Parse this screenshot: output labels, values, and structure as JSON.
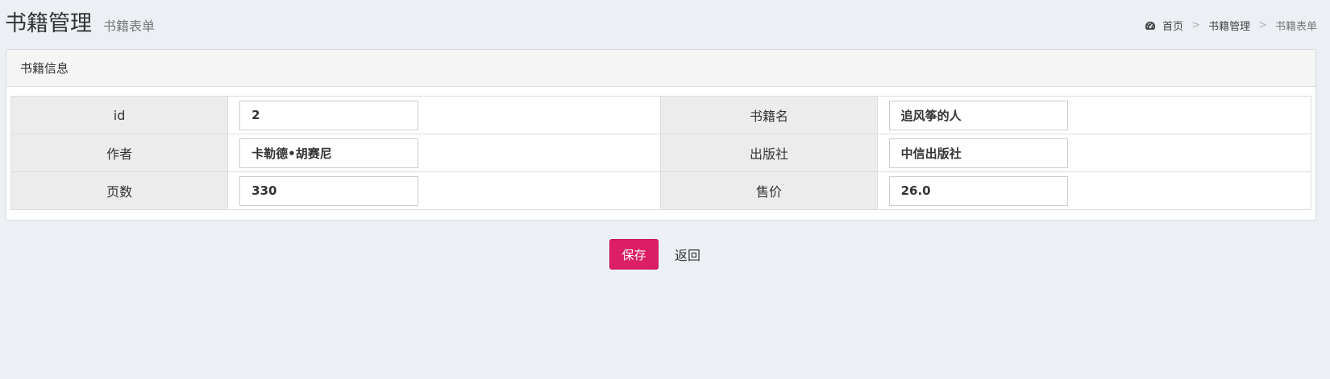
{
  "header": {
    "title": "书籍管理",
    "subtitle": "书籍表单"
  },
  "breadcrumb": {
    "icon": "dashboard-icon",
    "items": [
      "首页",
      "书籍管理",
      "书籍表单"
    ],
    "separator": ">"
  },
  "box": {
    "title": "书籍信息"
  },
  "form": {
    "rows": [
      [
        {
          "label": "id",
          "value": "2"
        },
        {
          "label": "书籍名",
          "value": "追风筝的人"
        }
      ],
      [
        {
          "label": "作者",
          "value": "卡勒德•胡赛尼"
        },
        {
          "label": "出版社",
          "value": "中信出版社"
        }
      ],
      [
        {
          "label": "页数",
          "value": "330"
        },
        {
          "label": "售价",
          "value": "26.0"
        }
      ]
    ]
  },
  "actions": {
    "save_label": "保存",
    "back_label": "返回"
  },
  "colors": {
    "background": "#ecf0f5",
    "save_button": "#dc1e64",
    "label_cell": "#ececec"
  }
}
